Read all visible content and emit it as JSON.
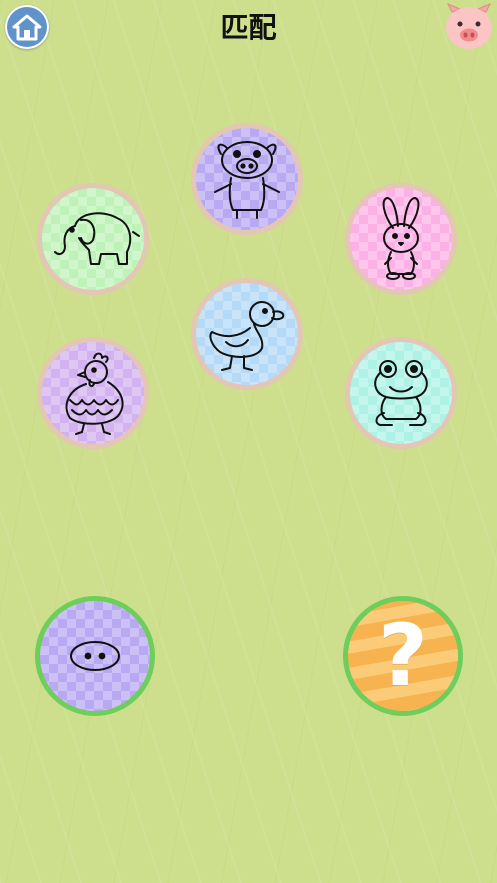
{
  "header": {
    "title": "匹配",
    "home_icon": "home-icon",
    "avatar_icon": "pig-face-icon"
  },
  "animals": [
    {
      "name": "pig",
      "icon": "pig-icon",
      "color": "#b9a9f2"
    },
    {
      "name": "elephant",
      "icon": "elephant-icon",
      "color": "#bff2b8"
    },
    {
      "name": "rabbit",
      "icon": "rabbit-icon",
      "color": "#fbb0e6"
    },
    {
      "name": "duck",
      "icon": "duck-icon",
      "color": "#b4daf7"
    },
    {
      "name": "chicken",
      "icon": "chicken-icon",
      "color": "#d2b2f0"
    },
    {
      "name": "frog",
      "icon": "frog-icon",
      "color": "#aef2e6"
    }
  ],
  "clue": {
    "icon": "pig-nose-icon",
    "color": "#b9a9f2"
  },
  "answer": {
    "label": "?",
    "color": "#f7b350"
  },
  "colors": {
    "background": "#cdde8c",
    "tile_border": "#e3c6b4",
    "ring": "#6dce5c",
    "home": "#5f93c9"
  }
}
